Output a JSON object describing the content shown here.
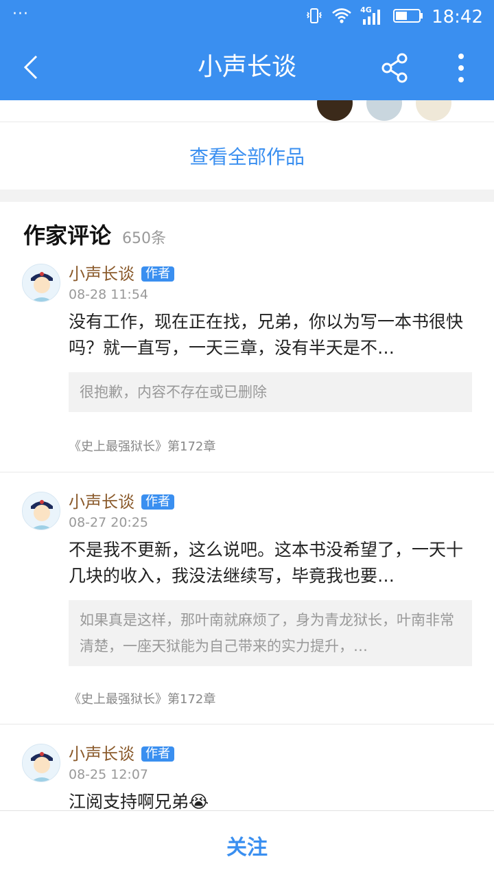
{
  "status_bar": {
    "notif": "···",
    "network": "4G",
    "time": "18:42"
  },
  "app_bar": {
    "title": "小声长谈",
    "back_icon": "back-chevron-icon",
    "share_icon": "share-icon",
    "more_icon": "more-vertical-icon"
  },
  "works": {
    "view_all_label": "查看全部作品"
  },
  "comments_section": {
    "title": "作家评论",
    "count": "650条",
    "items": [
      {
        "author": "小声长谈",
        "badge": "作者",
        "time": "08-28 11:54",
        "text": "没有工作，现在正在找，兄弟，你以为写一本书很快吗？就一直写，一天三章，没有半天是不…",
        "quote": "很抱歉，内容不存在或已删除",
        "source": "《史上最强狱长》第172章"
      },
      {
        "author": "小声长谈",
        "badge": "作者",
        "time": "08-27 20:25",
        "text": "不是我不更新，这么说吧。这本书没希望了，一天十几块的收入，我没法继续写，毕竟我也要…",
        "quote": "如果真是这样，那叶南就麻烦了，身为青龙狱长，叶南非常清楚，一座天狱能为自己带来的实力提升，…",
        "source": "《史上最强狱长》第172章"
      },
      {
        "author": "小声长谈",
        "badge": "作者",
        "time": "08-25 12:07",
        "text": "江阅支持啊兄弟😭"
      }
    ]
  },
  "bottom_bar": {
    "follow_label": "关注"
  },
  "colors": {
    "primary": "#3a8ff0",
    "author_name": "#8a5a2b",
    "quote_bg": "#f2f2f2"
  }
}
